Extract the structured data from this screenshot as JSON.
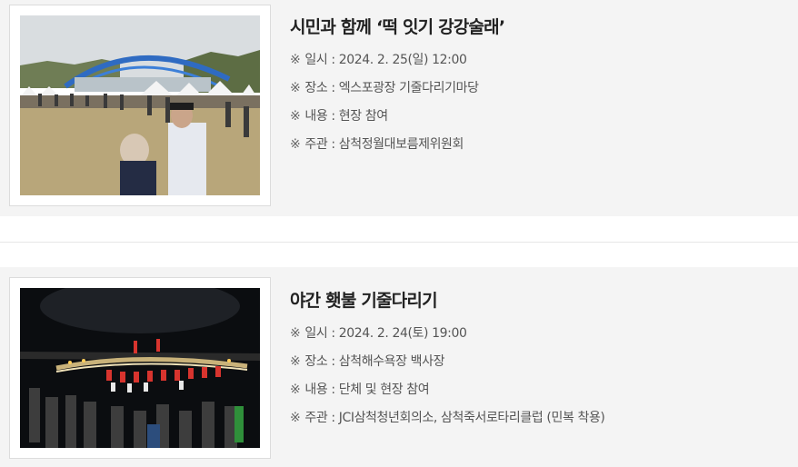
{
  "events": [
    {
      "title": "시민과 함께 ‘떡 잇기 강강술래’",
      "mark": "※",
      "rows": [
        {
          "label": "일시",
          "value": "2024. 2. 25(일) 12:00"
        },
        {
          "label": "장소",
          "value": "엑스포광장 기줄다리기마당"
        },
        {
          "label": "내용",
          "value": "현장 참여"
        },
        {
          "label": "주관",
          "value": "삼척정월대보름제위원회"
        }
      ]
    },
    {
      "title": "야간 횃불 기줄다리기",
      "mark": "※",
      "rows": [
        {
          "label": "일시",
          "value": "2024. 2. 24(토) 19:00"
        },
        {
          "label": "장소",
          "value": "삼척해수욕장 백사장"
        },
        {
          "label": "내용",
          "value": "단체 및 현장 참여"
        },
        {
          "label": "주관",
          "value": "JCI삼척청년회의소, 삼척죽서로타리클럽 (민복 착용)"
        }
      ]
    }
  ],
  "separator": " : "
}
